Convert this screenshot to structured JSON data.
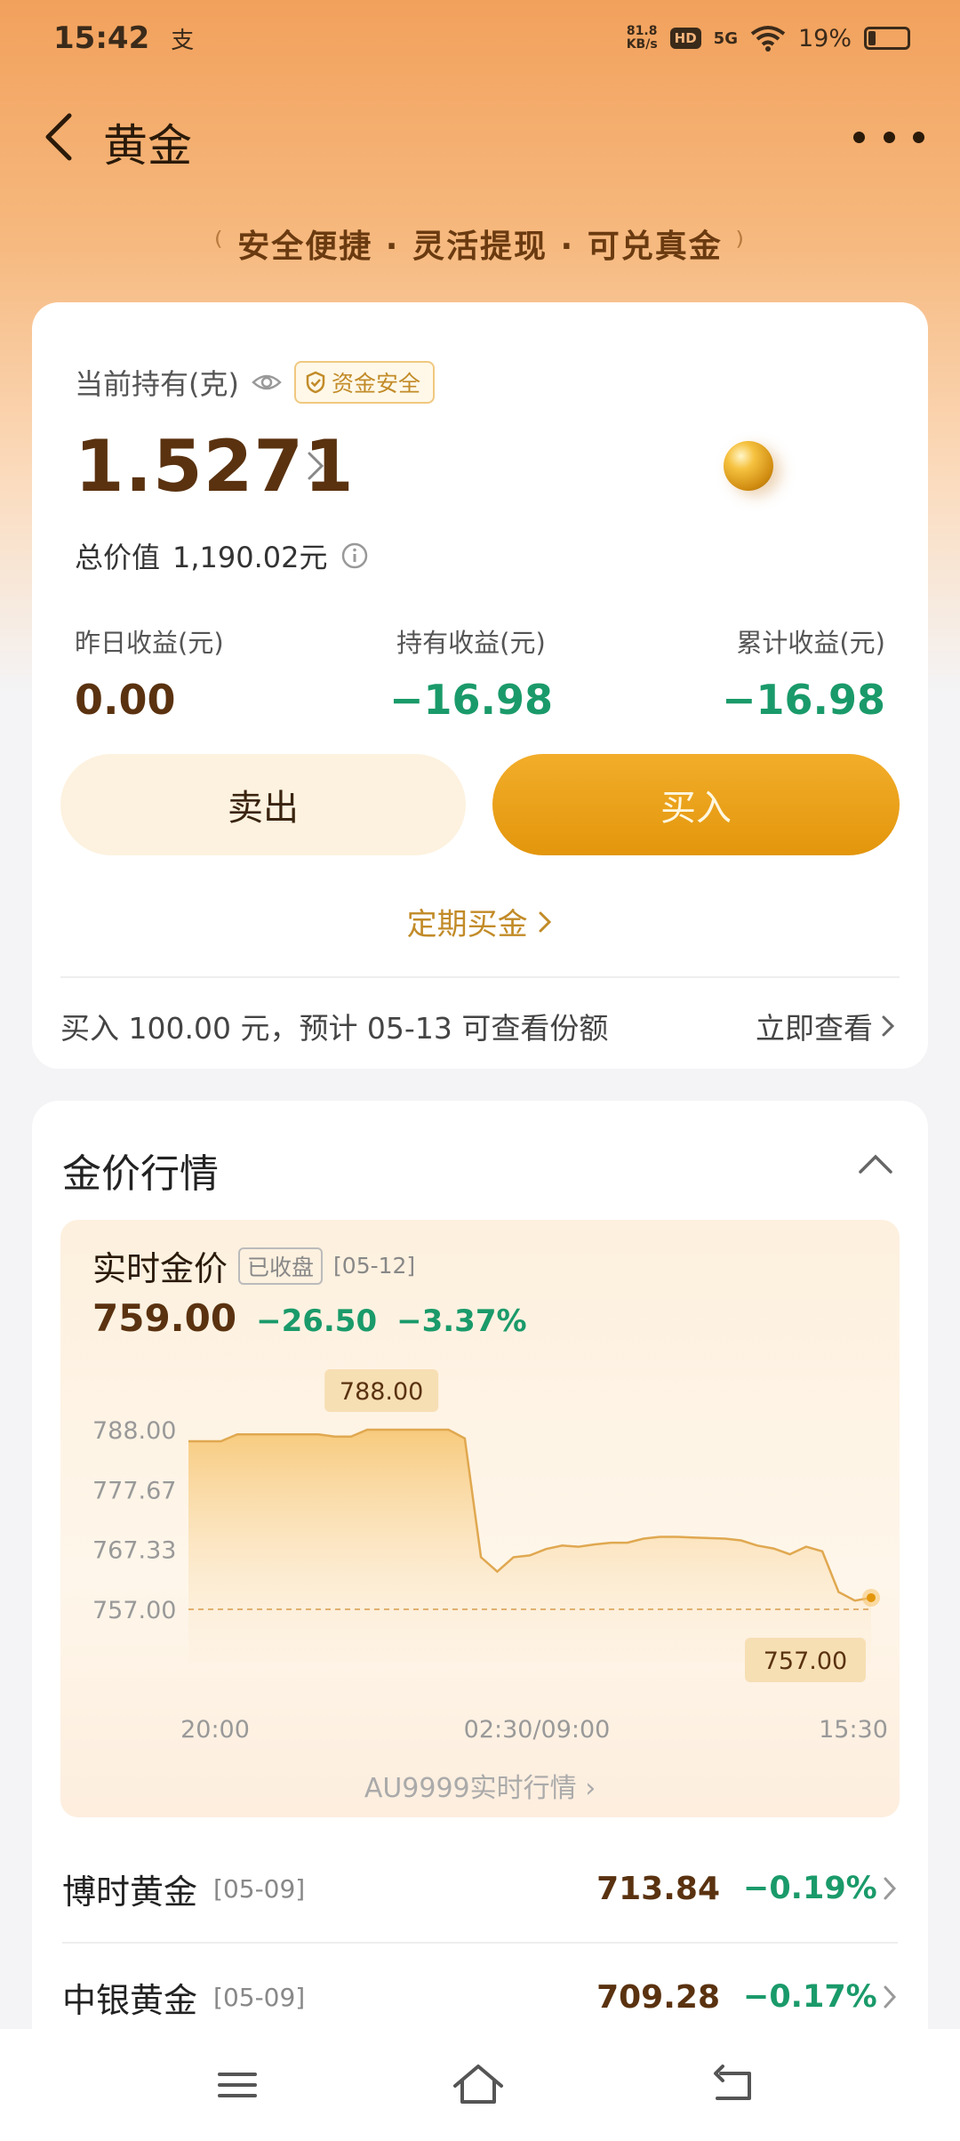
{
  "status": {
    "time": "15:42",
    "app_icon": "支",
    "net_speed_value": "81.8",
    "net_speed_unit": "KB/s",
    "hd": "HD",
    "signal": "5G",
    "battery": "19%",
    "battery_level": 0.19
  },
  "header": {
    "title": "黄金",
    "back_icon": "chevron-left-icon",
    "more_icon": "more-dots-icon"
  },
  "slogan": "安全便捷 · 灵活提现 · 可兑真金",
  "holding": {
    "label": "当前持有(克)",
    "safe_badge": "资金安全",
    "amount": "1.5271",
    "total_label": "总价值",
    "total_value": "1,190.02元",
    "stats": [
      {
        "label": "昨日收益(元)",
        "value": "0.00"
      },
      {
        "label": "持有收益(元)",
        "value": "−16.98"
      },
      {
        "label": "累计收益(元)",
        "value": "−16.98"
      }
    ],
    "sell_label": "卖出",
    "buy_label": "买入",
    "regular_buy_label": "定期买金",
    "notice": "买入 100.00 元，预计 05-13 可查看份额",
    "notice_link": "立即查看"
  },
  "market": {
    "title": "金价行情",
    "realtime_title": "实时金价",
    "closed_badge": "已收盘",
    "date": "[05-12]",
    "price": "759.00",
    "change": "−26.50",
    "change_pct": "−3.37%",
    "au_link": "AU9999实时行情",
    "colors": {
      "up": "#e04040",
      "down": "#1a9a6a",
      "gold": "#e3960c",
      "brand_text": "#5a3210"
    }
  },
  "chart_data": {
    "type": "area",
    "y_ticks": [
      "788.00",
      "777.67",
      "767.33",
      "757.00"
    ],
    "ylim": [
      757.0,
      788.0
    ],
    "x_ticks": [
      "20:00",
      "02:30/09:00",
      "15:30"
    ],
    "max_label": "788.00",
    "min_label": "757.00",
    "reference_line": 757.0,
    "series": [
      {
        "values": [
          786.0,
          786.0,
          786.0,
          787.2,
          787.2,
          787.2,
          787.2,
          787.2,
          787.2,
          786.8,
          786.8,
          788.0,
          788.0,
          788.0,
          788.0,
          788.0,
          788.0,
          786.5,
          766.0,
          763.5,
          766.0,
          766.3,
          767.4,
          768.0,
          767.8,
          768.2,
          768.5,
          768.5,
          769.2,
          769.5,
          769.5,
          769.4,
          769.3,
          769.2,
          768.9,
          768.0,
          767.5,
          766.5,
          767.8,
          767.0,
          760.0,
          758.5,
          759.0
        ]
      }
    ]
  },
  "funds": [
    {
      "name": "博时黄金",
      "date": "[05-09]",
      "price": "713.84",
      "change": "−0.19%"
    },
    {
      "name": "中银黄金",
      "date": "[05-09]",
      "price": "709.28",
      "change": "−0.17%"
    }
  ],
  "navbar": {
    "menu_icon": "menu-icon",
    "home_icon": "home-icon",
    "back_icon": "back-return-icon"
  }
}
